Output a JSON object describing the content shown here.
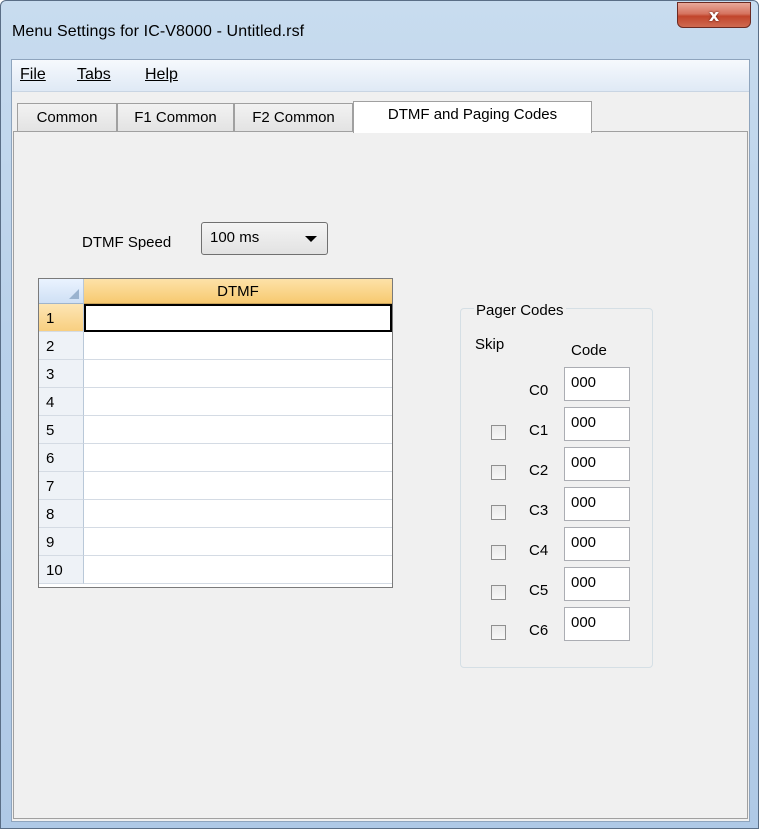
{
  "window": {
    "title": "Menu Settings for IC-V8000 - Untitled.rsf",
    "close_glyph": "x"
  },
  "menu": {
    "file": "File",
    "tabs": "Tabs",
    "help": "Help"
  },
  "tabs": [
    "Common",
    "F1 Common",
    "F2 Common",
    "DTMF and Paging Codes"
  ],
  "dtmf_speed": {
    "label": "DTMF Speed",
    "value": "100 ms"
  },
  "dtmf_grid": {
    "header": "DTMF",
    "rows": [
      "1",
      "2",
      "3",
      "4",
      "5",
      "6",
      "7",
      "8",
      "9",
      "10"
    ],
    "values": [
      "",
      "",
      "",
      "",
      "",
      "",
      "",
      "",
      "",
      ""
    ]
  },
  "pager_codes": {
    "title": "Pager Codes",
    "skip_header": "Skip",
    "code_header": "Code",
    "items": [
      {
        "label": "C0",
        "code": "000",
        "has_skip": false,
        "skip": false
      },
      {
        "label": "C1",
        "code": "000",
        "has_skip": true,
        "skip": false
      },
      {
        "label": "C2",
        "code": "000",
        "has_skip": true,
        "skip": false
      },
      {
        "label": "C3",
        "code": "000",
        "has_skip": true,
        "skip": false
      },
      {
        "label": "C4",
        "code": "000",
        "has_skip": true,
        "skip": false
      },
      {
        "label": "C5",
        "code": "000",
        "has_skip": true,
        "skip": false
      },
      {
        "label": "C6",
        "code": "000",
        "has_skip": true,
        "skip": false
      }
    ]
  }
}
